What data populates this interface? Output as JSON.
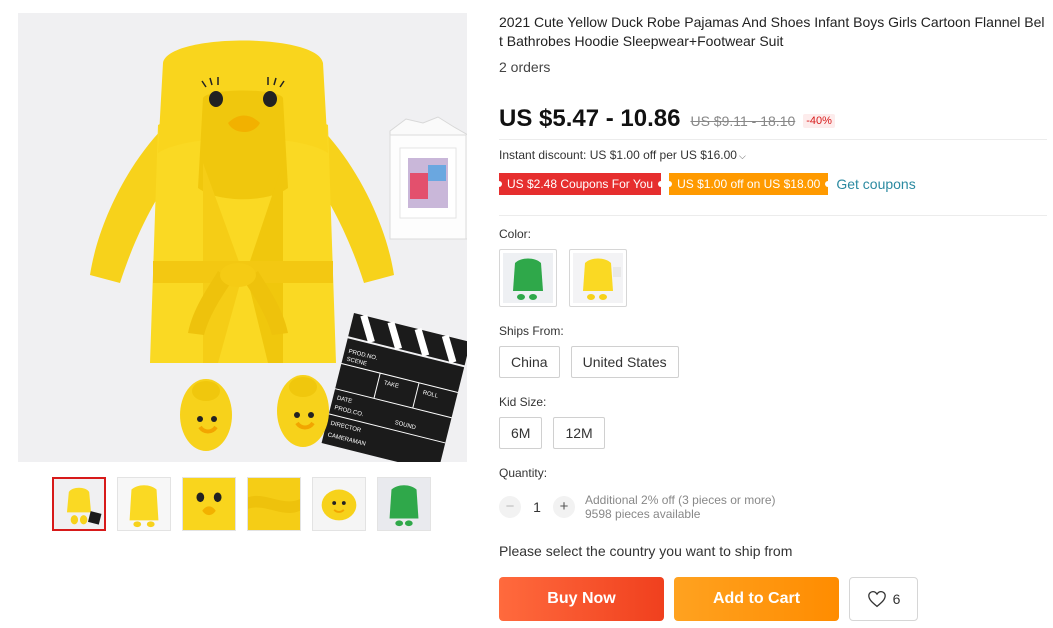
{
  "product": {
    "title": "2021 Cute Yellow Duck Robe Pajamas And Shoes Infant Boys Girls Cartoon Flannel Belt Bathrobes Hoodie Sleepwear+Footwear Suit",
    "orders": "2 orders",
    "price": "US $5.47 - 10.86",
    "original_price": "US $9.11 - 18.10",
    "discount": "-40%",
    "instant_discount": "Instant discount: US $1.00 off per US $16.00",
    "coupons": [
      "US $2.48 Coupons For You",
      "US $1.00 off on US $18.00"
    ],
    "get_coupons": "Get coupons"
  },
  "gallery": {
    "main_image": "yellow-duck-robe-photo",
    "clapper_lines": [
      "PROD.NO.",
      "SCENE",
      "TAKE",
      "ROLL",
      "DATE",
      "PROD.CO.",
      "SOUND",
      "DIRECTOR",
      "CAMERAMAN"
    ],
    "thumbnails": [
      "robe-with-slippers",
      "robe-front",
      "duck-hood-closeup",
      "robe-fabric-closeup",
      "duck-slippers",
      "green-robe"
    ],
    "active_index": 0
  },
  "options": {
    "color_label": "Color:",
    "colors": [
      "green",
      "yellow"
    ],
    "ships_from_label": "Ships From:",
    "ships_from": [
      "China",
      "United States"
    ],
    "size_label": "Kid Size:",
    "sizes": [
      "6M",
      "12M"
    ],
    "quantity_label": "Quantity:",
    "quantity": "1",
    "qty_minus": "−",
    "qty_plus": "+",
    "additional_discount": "Additional 2% off (3 pieces or more)",
    "available": "9598 pieces available"
  },
  "shipping_note": "Please select the country you want to ship from",
  "actions": {
    "buy_now": "Buy Now",
    "add_to_cart": "Add to Cart",
    "wishlist_count": "6"
  },
  "colors": {
    "price_red": "#d71a1a",
    "coupon_red": "#e62e2e",
    "coupon_orange": "#ff9a00",
    "link_teal": "#2b8aa1",
    "buy_now": "#f0401e",
    "add_to_cart": "#ff8c00"
  }
}
